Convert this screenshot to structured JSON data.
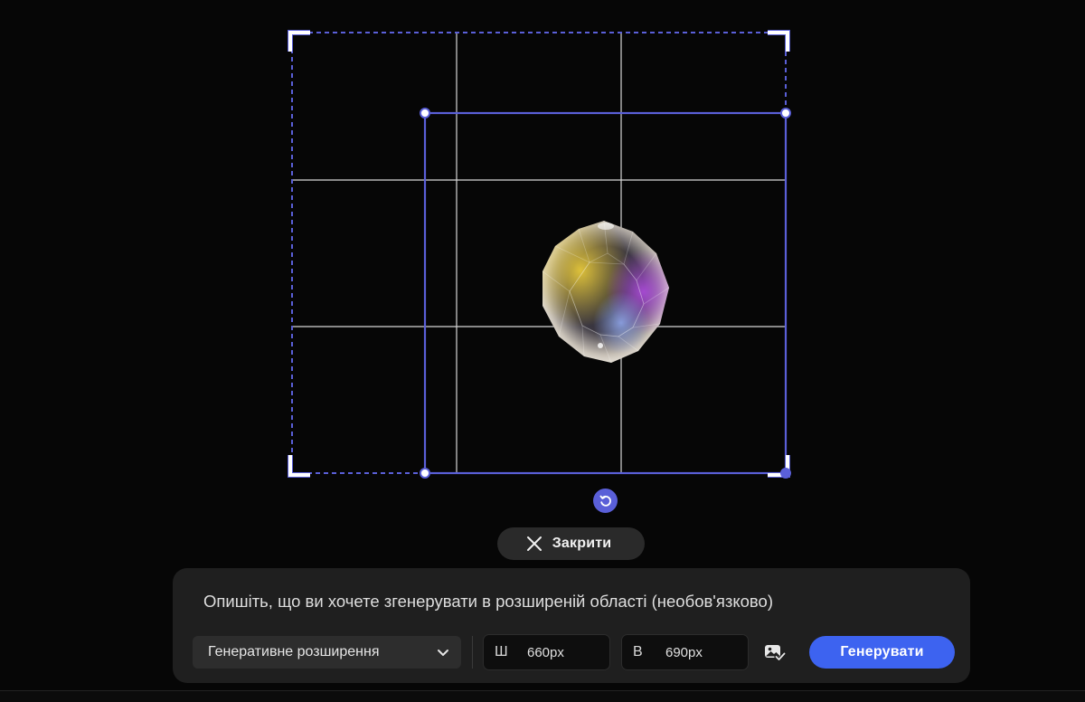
{
  "colors": {
    "accent": "#5a5fd8",
    "generate_button": "#3d63f0",
    "panel": "#1f1f1f"
  },
  "canvas": {
    "reset_icon": "rotate-ccw-icon"
  },
  "close_button": {
    "icon": "close-icon",
    "label": "Закрити"
  },
  "prompt": {
    "placeholder": "Опишіть, що ви хочете згенерувати в розширеній області (необов'язково)",
    "value": ""
  },
  "mode_select": {
    "selected": "Генеративне розширення",
    "icon": "chevron-down-icon"
  },
  "width_field": {
    "prefix": "Ш",
    "value": "660px"
  },
  "height_field": {
    "prefix": "В",
    "value": "690px"
  },
  "image_toggle": {
    "icon": "image-check-icon"
  },
  "generate_button": {
    "label": "Генерувати"
  }
}
